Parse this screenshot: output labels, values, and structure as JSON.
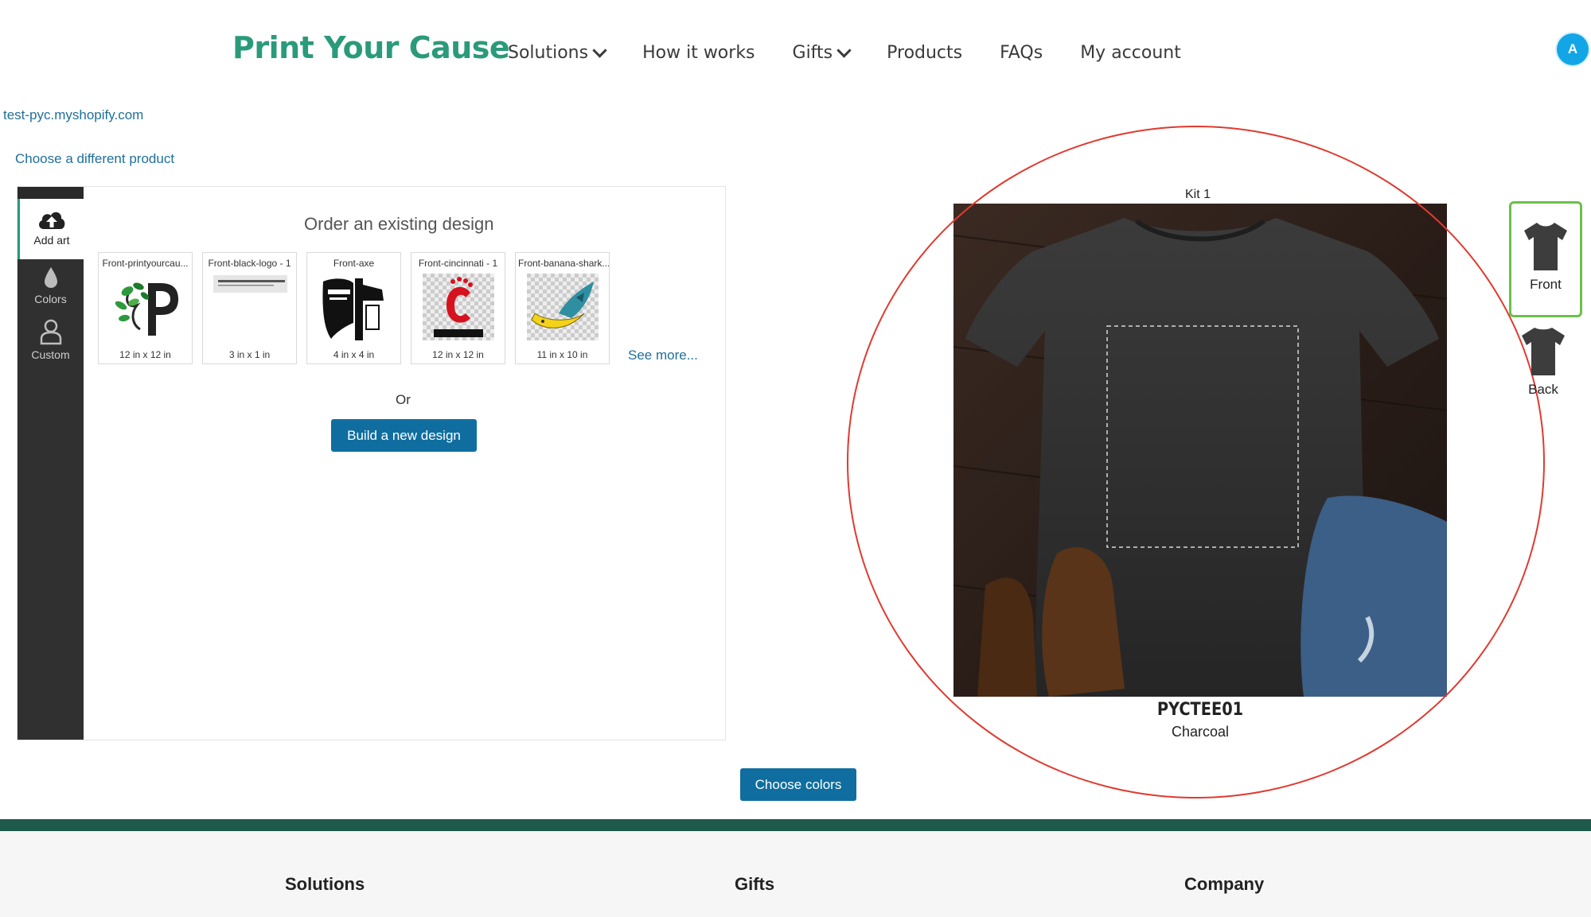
{
  "header": {
    "logo": "Print Your Cause",
    "nav": [
      "Solutions",
      "How it works",
      "Gifts",
      "Products",
      "FAQs",
      "My account"
    ],
    "avatar_initial": "A"
  },
  "shop_domain": "test-pyc.myshopify.com",
  "choose_product_link": "Choose a different product",
  "sidebar": {
    "items": [
      {
        "label": "Add art",
        "icon": "cloud-upload-icon"
      },
      {
        "label": "Colors",
        "icon": "droplet-icon"
      },
      {
        "label": "Custom",
        "icon": "person-icon"
      }
    ]
  },
  "designer": {
    "title": "Order an existing design",
    "designs": [
      {
        "name": "Front-printyourcau...",
        "size": "12 in x 12 in"
      },
      {
        "name": "Front-black-logo - 1",
        "size": "3 in x 1 in"
      },
      {
        "name": "Front-axe",
        "size": "4 in x 4 in"
      },
      {
        "name": "Front-cincinnati - 1",
        "size": "12 in x 12 in"
      },
      {
        "name": "Front-banana-shark...",
        "size": "11 in x 10 in"
      }
    ],
    "see_more": "See more...",
    "or_text": "Or",
    "build_button": "Build a new design"
  },
  "product": {
    "kit_label": "Kit 1",
    "code": "PYCTEE01",
    "color_name": "Charcoal",
    "views": [
      "Front",
      "Back"
    ]
  },
  "choose_colors_button": "Choose colors",
  "footer": {
    "headings": [
      "Solutions",
      "Gifts",
      "Company"
    ]
  }
}
